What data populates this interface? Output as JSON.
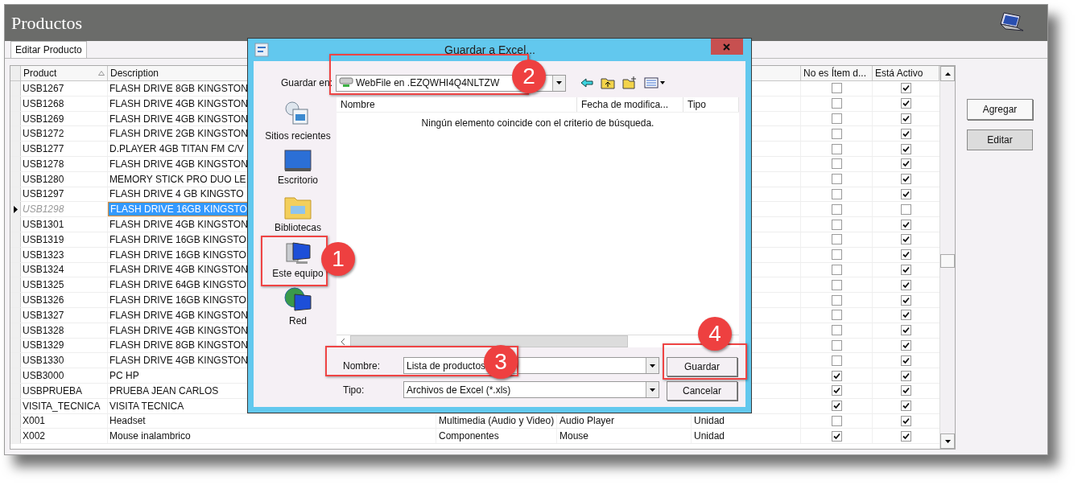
{
  "window": {
    "title": "Productos"
  },
  "tabs": [
    {
      "label": "Editar Producto",
      "selected": true
    }
  ],
  "table": {
    "columns": [
      {
        "label": "Product",
        "sorted": true
      },
      {
        "label": "Description"
      },
      {
        "label": "No es Ítem d...",
        "sorted": false
      },
      {
        "label": "Está Activo",
        "sorted": false
      }
    ],
    "rows": [
      {
        "product": "USB1267",
        "description": "FLASH DRIVE 8GB KINGSTON",
        "no_es_item": false,
        "activo": true,
        "selected": false
      },
      {
        "product": "USB1268",
        "description": "FLASH DRIVE 4GB KINGSTON",
        "no_es_item": false,
        "activo": true,
        "selected": false
      },
      {
        "product": "USB1269",
        "description": "FLASH DRIVE 4GB KINGSTON",
        "no_es_item": false,
        "activo": true,
        "selected": false
      },
      {
        "product": "USB1272",
        "description": "FLASH DRIVE 2GB KINGSTON",
        "no_es_item": false,
        "activo": true,
        "selected": false
      },
      {
        "product": "USB1277",
        "description": "D.PLAYER 4GB TITAN FM C/V",
        "no_es_item": false,
        "activo": true,
        "selected": false
      },
      {
        "product": "USB1278",
        "description": "FLASH DRIVE 4GB KINGSTON",
        "no_es_item": false,
        "activo": true,
        "selected": false
      },
      {
        "product": "USB1280",
        "description": "MEMORY STICK PRO DUO LE",
        "no_es_item": false,
        "activo": true,
        "selected": false
      },
      {
        "product": "USB1297",
        "description": "FLASH DRIVE 4 GB KINGSTO",
        "no_es_item": false,
        "activo": true,
        "selected": false
      },
      {
        "product": "USB1298",
        "description": "FLASH DRIVE 16GB KINGSTO",
        "no_es_item": false,
        "activo": false,
        "selected": true
      },
      {
        "product": "USB1301",
        "description": "FLASH DRIVE 4GB KINGSTON",
        "no_es_item": false,
        "activo": true,
        "selected": false
      },
      {
        "product": "USB1319",
        "description": "FLASH DRIVE 16GB KINGSTO",
        "no_es_item": false,
        "activo": true,
        "selected": false
      },
      {
        "product": "USB1323",
        "description": "FLASH DRIVE 16GB KINGSTO",
        "no_es_item": false,
        "activo": true,
        "selected": false
      },
      {
        "product": "USB1324",
        "description": "FLASH DRIVE 4GB KINGSTON",
        "no_es_item": false,
        "activo": true,
        "selected": false
      },
      {
        "product": "USB1325",
        "description": "FLASH DRIVE 64GB KINGSTO",
        "no_es_item": false,
        "activo": true,
        "selected": false
      },
      {
        "product": "USB1326",
        "description": "FLASH DRIVE 16GB KINGSTO",
        "no_es_item": false,
        "activo": true,
        "selected": false
      },
      {
        "product": "USB1327",
        "description": "FLASH DRIVE 4GB KINGSTON",
        "no_es_item": false,
        "activo": true,
        "selected": false
      },
      {
        "product": "USB1328",
        "description": "FLASH DRIVE 4GB KINGSTON",
        "no_es_item": false,
        "activo": true,
        "selected": false
      },
      {
        "product": "USB1329",
        "description": "FLASH DRIVE 8GB KINGSTON",
        "no_es_item": false,
        "activo": true,
        "selected": false
      },
      {
        "product": "USB1330",
        "description": "FLASH DRIVE 4GB KINGSTON",
        "no_es_item": false,
        "activo": true,
        "selected": false
      },
      {
        "product": "USB3000",
        "description": "PC HP",
        "no_es_item": true,
        "activo": true,
        "selected": false
      },
      {
        "product": "USBPRUEBA",
        "description": "PRUEBA JEAN CARLOS",
        "no_es_item": true,
        "activo": true,
        "selected": false
      },
      {
        "product": "VISITA_TECNICA",
        "description": "VISITA TECNICA",
        "no_es_item": true,
        "activo": true,
        "selected": false
      },
      {
        "product": "X001",
        "description": "Headset",
        "column_3": "Multimedia (Audio y Video)",
        "column_4": "Audio Player",
        "column_5": "Unidad",
        "no_es_item": false,
        "activo": true,
        "selected": false
      },
      {
        "product": "X002",
        "description": "Mouse inalambrico",
        "column_3": "Componentes",
        "column_4": "Mouse",
        "column_5": "Unidad",
        "no_es_item": true,
        "activo": true,
        "selected": false
      }
    ]
  },
  "buttons": [
    {
      "label": "Agregar",
      "pressed": false
    },
    {
      "label": "Editar",
      "pressed": true
    }
  ],
  "dialog": {
    "title": "Guardar a Excel...",
    "save_in_label": "Guardar en:",
    "save_in_value": "WebFile en .EZQWHI4Q4NLTZW",
    "places": [
      {
        "label": "Sitios recientes",
        "kind": "recent"
      },
      {
        "label": "Escritorio",
        "kind": "desktop"
      },
      {
        "label": "Bibliotecas",
        "kind": "libraries"
      },
      {
        "label": "Este equipo",
        "kind": "computer"
      },
      {
        "label": "Red",
        "kind": "network"
      }
    ],
    "list_columns": [
      "Nombre",
      "Fecha de modifica...",
      "Tipo"
    ],
    "empty_message": "Ningún elemento coincide con el criterio de búsqueda.",
    "filename_label": "Nombre:",
    "filename_value": "Lista de productos",
    "type_label": "Tipo:",
    "type_value": "Archivos de Excel (*.xls)",
    "buttons": [
      "Guardar",
      "Cancelar"
    ]
  },
  "annotations": [
    {
      "number": "1"
    },
    {
      "number": "2"
    },
    {
      "number": "3"
    },
    {
      "number": "4"
    }
  ]
}
